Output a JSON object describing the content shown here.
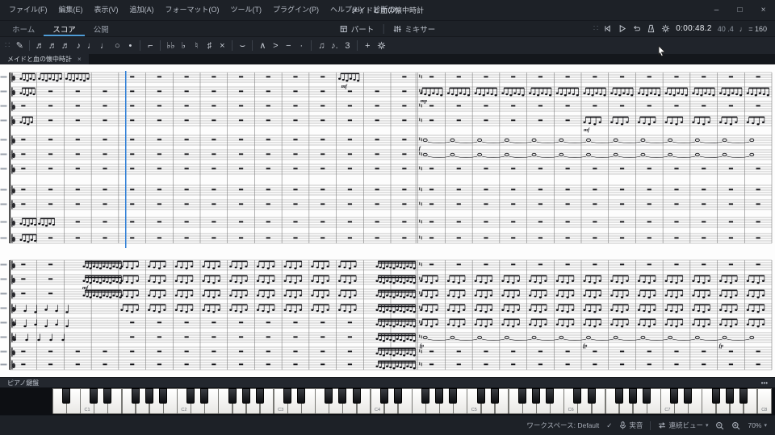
{
  "window": {
    "title": "メイドと血の懐中時計",
    "minimize": "–",
    "maximize": "□",
    "close": "×"
  },
  "icons": {
    "handle": "∷",
    "caret_down": "▾",
    "check": "✓",
    "more": "•••"
  },
  "menu_bar": {
    "items": [
      "ファイル(F)",
      "編集(E)",
      "表示(V)",
      "追加(A)",
      "フォーマット(O)",
      "ツール(T)",
      "プラグイン(P)",
      "ヘルプ(H)",
      "診断(D)"
    ]
  },
  "main_tabs": {
    "active": "score",
    "items": [
      {
        "id": "home",
        "label": "ホーム"
      },
      {
        "id": "score",
        "label": "スコア"
      },
      {
        "id": "publish",
        "label": "公開"
      }
    ]
  },
  "center_actions": {
    "parts": "パート",
    "mixer": "ミキサー"
  },
  "playback": {
    "time": "0:00:48.2",
    "measure_beat": "40 .4",
    "tempo": "♩ = 160"
  },
  "note_input_toolbar": {
    "icons": [
      {
        "name": "note-input-button",
        "glyph": "✎"
      },
      {
        "sep": true
      },
      {
        "name": "duration-64th-button",
        "glyph": "♬"
      },
      {
        "name": "duration-32nd-button",
        "glyph": "♬"
      },
      {
        "name": "duration-16th-button",
        "glyph": "♬"
      },
      {
        "name": "duration-eighth-button",
        "glyph": "♪"
      },
      {
        "name": "duration-quarter-button",
        "glyph": "♩"
      },
      {
        "name": "duration-half-button",
        "glyph": "♩"
      },
      {
        "name": "duration-whole-button",
        "glyph": "○"
      },
      {
        "name": "augmentation-dot-button",
        "glyph": "•"
      },
      {
        "sep": true
      },
      {
        "name": "rest-button",
        "glyph": "⌐"
      },
      {
        "sep": true
      },
      {
        "name": "flat-flat-button",
        "glyph": "♭♭"
      },
      {
        "name": "flat-button",
        "glyph": "♭"
      },
      {
        "name": "natural-button",
        "glyph": "♮"
      },
      {
        "name": "sharp-button",
        "glyph": "♯"
      },
      {
        "name": "double-sharp-button",
        "glyph": "×"
      },
      {
        "sep": true
      },
      {
        "name": "tie-button",
        "glyph": "⌣"
      },
      {
        "sep": true
      },
      {
        "name": "marcato-button",
        "glyph": "∧"
      },
      {
        "name": "accent-button",
        "glyph": ">"
      },
      {
        "name": "tenuto-button",
        "glyph": "−"
      },
      {
        "name": "staccato-button",
        "glyph": "·"
      },
      {
        "sep": true
      },
      {
        "name": "beam-button",
        "glyph": "♫"
      },
      {
        "name": "dotted-note-button",
        "glyph": "♪."
      },
      {
        "name": "tuplet-button",
        "glyph": "3"
      },
      {
        "sep": true
      },
      {
        "name": "add-button",
        "glyph": "+"
      }
    ]
  },
  "document_tabs": {
    "items": [
      {
        "label": "メイドと血の懐中時計",
        "close": "×"
      }
    ]
  },
  "score": {
    "dynamics": {
      "mf": "mf",
      "mp": "mp",
      "f": "f",
      "fp": "fp"
    },
    "cursor_color": "#2f7fd6"
  },
  "piano_panel": {
    "title": "ピアノ鍵盤",
    "octave_labels": [
      "C1",
      "C2",
      "C3",
      "C4",
      "C5",
      "C6",
      "C7",
      "C8"
    ]
  },
  "status_bar": {
    "workspace": "ワークスペース: Default",
    "concert_pitch": "実音",
    "view_mode": "連続ビュー",
    "zoom": "70%"
  }
}
